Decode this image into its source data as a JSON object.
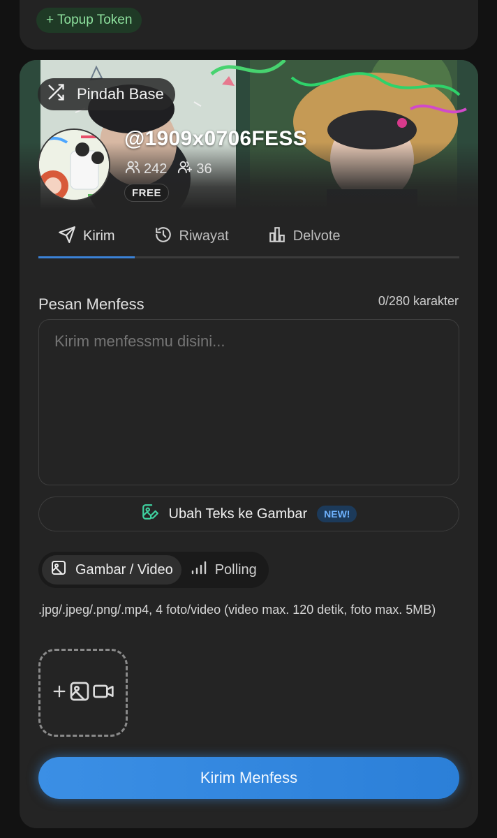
{
  "top_card": {
    "topup_label": "+ Topup Token"
  },
  "profile": {
    "switch_label": "Pindah Base",
    "username": "@1909x0706FESS",
    "followers": "242",
    "following": "36",
    "plan": "FREE"
  },
  "tabs": [
    {
      "label": "Kirim",
      "icon": "send-icon",
      "active": true
    },
    {
      "label": "Riwayat",
      "icon": "history-icon",
      "active": false
    },
    {
      "label": "Delvote",
      "icon": "bar-chart-icon",
      "active": false
    }
  ],
  "form": {
    "message_label": "Pesan Menfess",
    "char_count": "0/280 karakter",
    "message_placeholder": "Kirim menfessmu disini...",
    "message_value": "",
    "convert_label": "Ubah Teks ke Gambar",
    "new_badge": "NEW!",
    "media_options": [
      {
        "label": "Gambar / Video",
        "active": true
      },
      {
        "label": "Polling",
        "active": false
      }
    ],
    "file_hint": ".jpg/.jpeg/.png/.mp4, 4 foto/video (video max. 120 detik, foto max. 5MB)",
    "submit_label": "Kirim Menfess"
  },
  "colors": {
    "accent": "#3b82d6",
    "submit": "#3b8fe5",
    "topup_text": "#8fe39f",
    "new_badge": "#6fb3ff"
  }
}
